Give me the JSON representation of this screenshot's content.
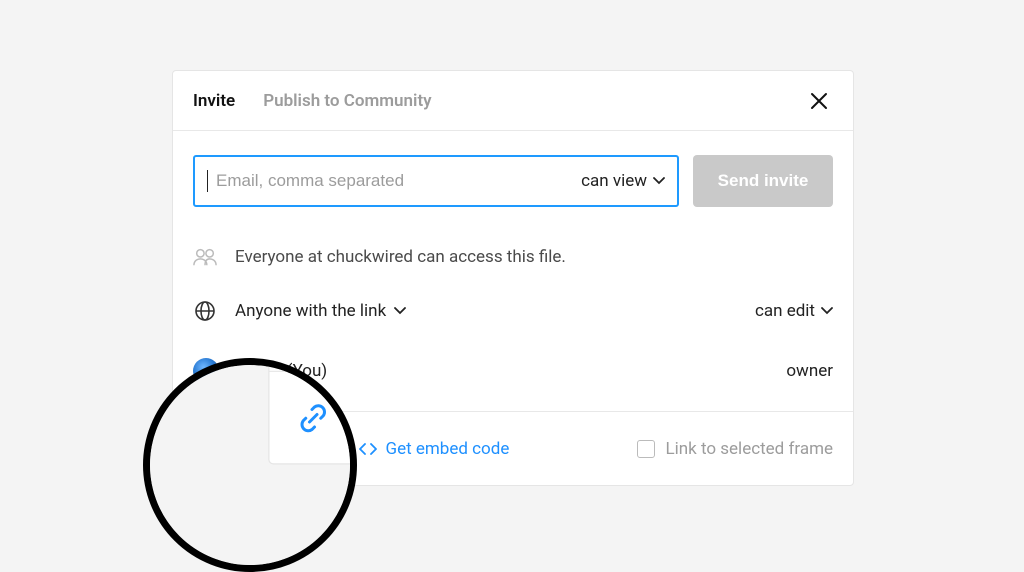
{
  "header": {
    "tab_invite": "Invite",
    "tab_publish": "Publish to Community"
  },
  "invite": {
    "email_placeholder": "Email, comma separated",
    "permission": "can view",
    "send_label": "Send invite"
  },
  "org_access_text": "Everyone at chuckwired can access this file.",
  "link_access": {
    "label": "Anyone with the link",
    "permission": "can edit"
  },
  "user": {
    "name": "k Rice (You)",
    "role": "owner"
  },
  "footer": {
    "copy_link": "Copy link",
    "embed": "Get embed code",
    "sel_frame": "Link to selected frame"
  }
}
